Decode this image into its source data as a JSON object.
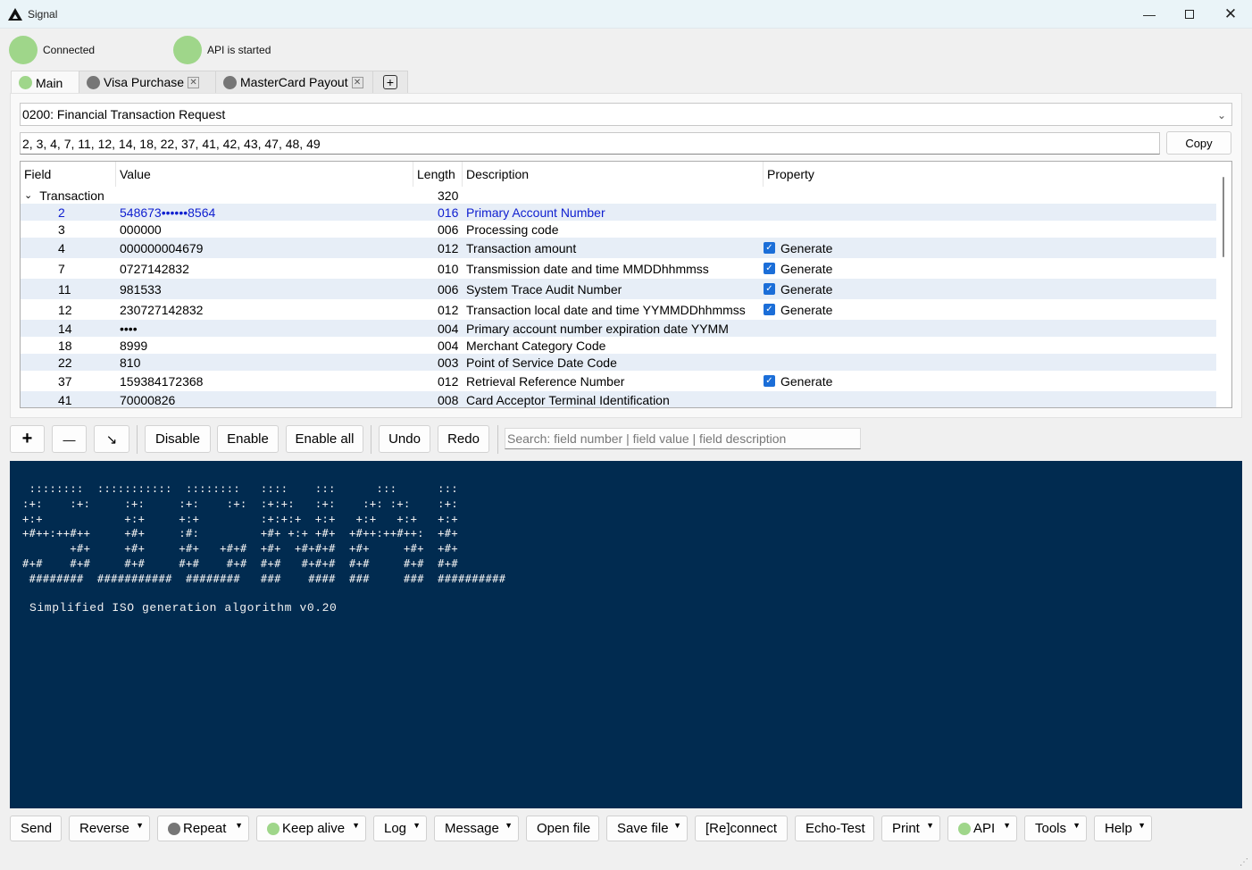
{
  "window": {
    "title": "Signal"
  },
  "status": {
    "connection": "Connected",
    "api": "API is started"
  },
  "tabs": [
    {
      "label": "Main",
      "active": true,
      "dot": "green"
    },
    {
      "label": "Visa Purchase",
      "active": false,
      "dot": "gray"
    },
    {
      "label": "MasterCard Payout",
      "active": false,
      "dot": "gray"
    }
  ],
  "message_type": "0200: Financial Transaction Request",
  "field_list": "2, 3, 4, 7, 11, 12, 14, 18, 22, 37, 41, 42, 43, 47, 48, 49",
  "copy_label": "Copy",
  "table": {
    "headers": [
      "Field",
      "Value",
      "Length",
      "Description",
      "Property"
    ],
    "group": {
      "label": "Transaction",
      "length": "320"
    },
    "rows": [
      {
        "field": "2",
        "value": "548673••••••8564",
        "length": "016",
        "desc": "Primary Account Number",
        "prop": ""
      },
      {
        "field": "3",
        "value": "000000",
        "length": "006",
        "desc": "Processing code",
        "prop": ""
      },
      {
        "field": "4",
        "value": "000000004679",
        "length": "012",
        "desc": "Transaction amount",
        "prop": "Generate"
      },
      {
        "field": "7",
        "value": "0727142832",
        "length": "010",
        "desc": "Transmission date and time MMDDhhmmss",
        "prop": "Generate"
      },
      {
        "field": "11",
        "value": "981533",
        "length": "006",
        "desc": "System Trace Audit Number",
        "prop": "Generate"
      },
      {
        "field": "12",
        "value": "230727142832",
        "length": "012",
        "desc": "Transaction local date and time YYMMDDhhmmss",
        "prop": "Generate"
      },
      {
        "field": "14",
        "value": "••••",
        "length": "004",
        "desc": "Primary account number expiration date YYMM",
        "prop": ""
      },
      {
        "field": "18",
        "value": "8999",
        "length": "004",
        "desc": "Merchant Category Code",
        "prop": ""
      },
      {
        "field": "22",
        "value": "810",
        "length": "003",
        "desc": "Point of Service Date Code",
        "prop": ""
      },
      {
        "field": "37",
        "value": "159384172368",
        "length": "012",
        "desc": "Retrieval Reference Number",
        "prop": "Generate"
      },
      {
        "field": "41",
        "value": "70000826",
        "length": "008",
        "desc": "Card Acceptor Terminal Identification",
        "prop": ""
      }
    ]
  },
  "toolbar": {
    "add": "+",
    "remove": "—",
    "disable": "Disable",
    "enable": "Enable",
    "enable_all": "Enable all",
    "undo": "Undo",
    "redo": "Redo",
    "search_placeholder": "Search: field number | field value | field description"
  },
  "console": {
    "banner": [
      " ::::::::  :::::::::::  ::::::::   ::::    :::      :::      :::",
      ":+:    :+:     :+:     :+:    :+:  :+:+:   :+:    :+: :+:    :+:",
      "+:+            +:+     +:+         :+:+:+  +:+   +:+   +:+   +:+",
      "+#++:++#++     +#+     :#:         +#+ +:+ +#+  +#++:++#++:  +#+",
      "       +#+     +#+     +#+   +#+#  +#+  +#+#+#  +#+     +#+  +#+",
      "#+#    #+#     #+#     #+#    #+#  #+#   #+#+#  #+#     #+#  #+#",
      " ########  ###########  ########   ###    ####  ###     ###  ##########"
    ],
    "subtitle": "Simplified ISO generation algorithm v0.20"
  },
  "bottom": {
    "send": "Send",
    "reverse": "Reverse",
    "repeat": "Repeat",
    "keep_alive": "Keep alive",
    "log": "Log",
    "message": "Message",
    "open_file": "Open file",
    "save_file": "Save file",
    "reconnect": "[Re]connect",
    "echo_test": "Echo-Test",
    "print": "Print",
    "api": "API",
    "tools": "Tools",
    "help": "Help"
  },
  "colors": {
    "led_on": "#9fd68a",
    "led_off": "#767676",
    "console_bg": "#012b50",
    "row_alt": "#e7eef7",
    "selected_text": "#1020d0"
  }
}
